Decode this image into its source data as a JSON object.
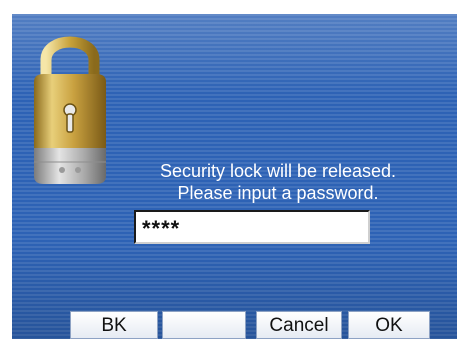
{
  "dialog": {
    "message_line1": "Security lock will be released.",
    "message_line2": "Please input a password.",
    "password_value": "****"
  },
  "softkeys": {
    "key1": "BK",
    "key2": "",
    "key3": "Cancel",
    "key4": "OK"
  },
  "colors": {
    "screen_background": "#2d62b5",
    "lock": "gold",
    "text": "#ffffff"
  },
  "icons": {
    "lock": "padlock-icon"
  }
}
